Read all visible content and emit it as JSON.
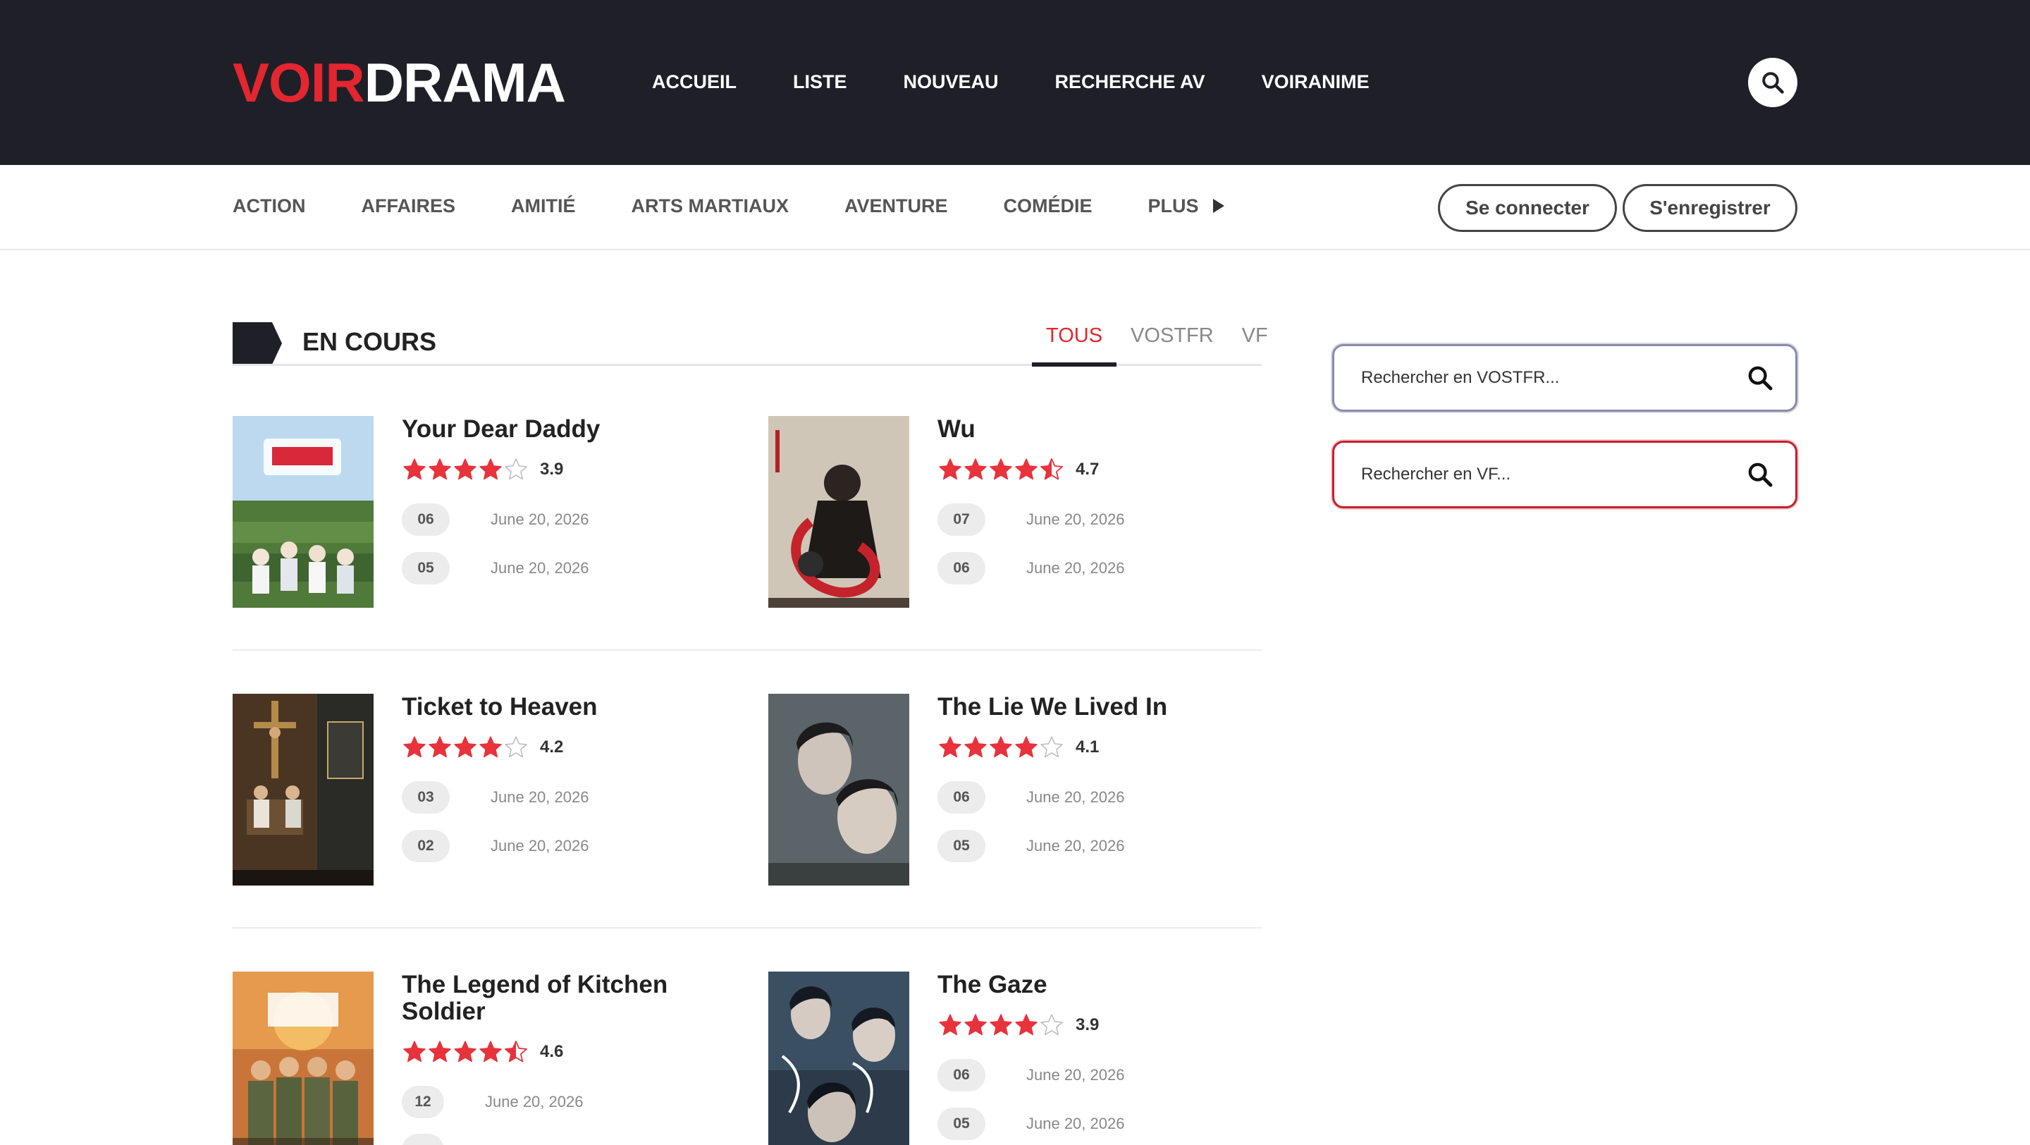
{
  "header": {
    "logo_part1": "VOIR",
    "logo_part2": "DRAMA",
    "nav": [
      "ACCUEIL",
      "LISTE",
      "NOUVEAU",
      "RECHERCHE AV",
      "VOIRANIME"
    ],
    "search_icon": "search-icon"
  },
  "genres": {
    "items": [
      "ACTION",
      "AFFAIRES",
      "AMITIÉ",
      "ARTS MARTIAUX",
      "AVENTURE",
      "COMÉDIE"
    ],
    "more": "PLUS"
  },
  "auth": {
    "login": "Se connecter",
    "register": "S'enregistrer"
  },
  "section": {
    "title": "EN COURS",
    "tabs": [
      "TOUS",
      "VOSTFR",
      "VF"
    ],
    "active_tab": "TOUS"
  },
  "colors": {
    "accent": "#e3262f",
    "header_bg": "#1f1f27",
    "star": "#e8323c"
  },
  "dramas": [
    {
      "title": "Your Dear Daddy",
      "rating": 3.9,
      "rating_text": "3.9",
      "episodes": [
        {
          "ep": "06",
          "date": "June 20, 2026"
        },
        {
          "ep": "05",
          "date": "June 20, 2026"
        }
      ]
    },
    {
      "title": "Wu",
      "rating": 4.7,
      "rating_text": "4.7",
      "episodes": [
        {
          "ep": "07",
          "date": "June 20, 2026"
        },
        {
          "ep": "06",
          "date": "June 20, 2026"
        }
      ]
    },
    {
      "title": "Ticket to Heaven",
      "rating": 4.2,
      "rating_text": "4.2",
      "episodes": [
        {
          "ep": "03",
          "date": "June 20, 2026"
        },
        {
          "ep": "02",
          "date": "June 20, 2026"
        }
      ]
    },
    {
      "title": "The Lie We Lived In",
      "rating": 4.1,
      "rating_text": "4.1",
      "episodes": [
        {
          "ep": "06",
          "date": "June 20, 2026"
        },
        {
          "ep": "05",
          "date": "June 20, 2026"
        }
      ]
    },
    {
      "title": "The Legend of Kitchen Soldier",
      "rating": 4.6,
      "rating_text": "4.6",
      "episodes": [
        {
          "ep": "12",
          "date": "June 20, 2026"
        }
      ]
    },
    {
      "title": "The Gaze",
      "rating": 3.9,
      "rating_text": "3.9",
      "episodes": [
        {
          "ep": "06",
          "date": "June 20, 2026"
        },
        {
          "ep": "05",
          "date": "June 20, 2026"
        }
      ]
    }
  ],
  "sidebar": {
    "search_vostfr_placeholder": "Rechercher en VOSTFR...",
    "search_vf_placeholder": "Rechercher en VF..."
  }
}
